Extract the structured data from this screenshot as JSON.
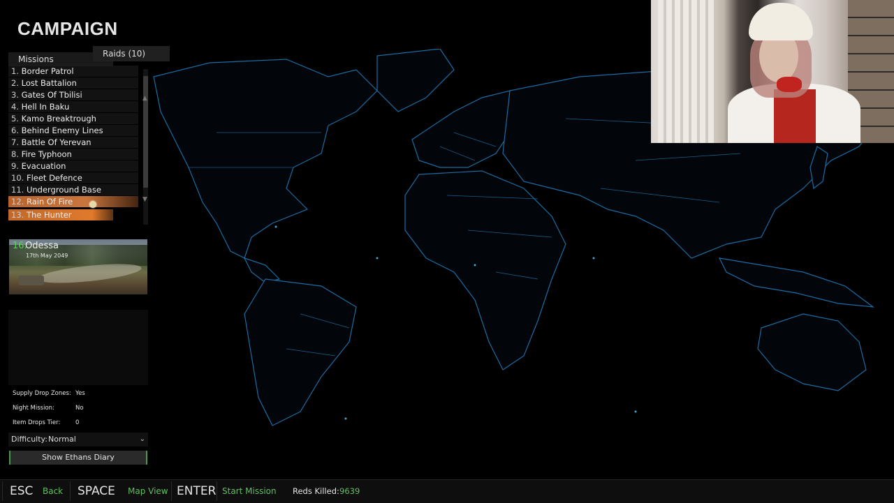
{
  "title": "CAMPAIGN",
  "tabs": {
    "missions": "Missions",
    "raids": "Raids (10)"
  },
  "missions": [
    {
      "num": "1.",
      "name": "Border Patrol"
    },
    {
      "num": "2.",
      "name": "Lost Battalion"
    },
    {
      "num": "3.",
      "name": "Gates Of Tbilisi"
    },
    {
      "num": "4.",
      "name": "Hell In Baku"
    },
    {
      "num": "5.",
      "name": "Kamo Breaktrough"
    },
    {
      "num": "6.",
      "name": "Behind Enemy Lines"
    },
    {
      "num": "7.",
      "name": "Battle Of Yerevan"
    },
    {
      "num": "8.",
      "name": "Fire Typhoon"
    },
    {
      "num": "9.",
      "name": "Evacuation"
    },
    {
      "num": "10.",
      "name": "Fleet Defence"
    },
    {
      "num": "11.",
      "name": "Underground Base"
    },
    {
      "num": "12.",
      "name": "Rain Of Fire"
    },
    {
      "num": "13.",
      "name": "The Hunter"
    }
  ],
  "selected_mission": {
    "num": "16.",
    "name": "Odessa",
    "date": "17th May 2049"
  },
  "mission_info": {
    "supply_drop_label": "Supply Drop Zones:",
    "supply_drop_value": "Yes",
    "night_mission_label": "Night Mission:",
    "night_mission_value": "No",
    "item_drops_label": "Item Drops Tier:",
    "item_drops_value": "0"
  },
  "difficulty": {
    "label": "Difficulty:",
    "value": "Normal"
  },
  "diary_button": "Show Ethans Diary",
  "controls": [
    {
      "key": "ESC",
      "action": "Back"
    },
    {
      "key": "SPACE",
      "action": "Map View"
    },
    {
      "key": "ENTER",
      "action": "Start Mission"
    }
  ],
  "stats": {
    "reds_killed_label": "Reds Killed:",
    "reds_killed_value": "9639"
  },
  "colors": {
    "accent_green": "#5fc15f",
    "highlight_orange": "#e07a2c",
    "map_border": "#1b6da5"
  }
}
